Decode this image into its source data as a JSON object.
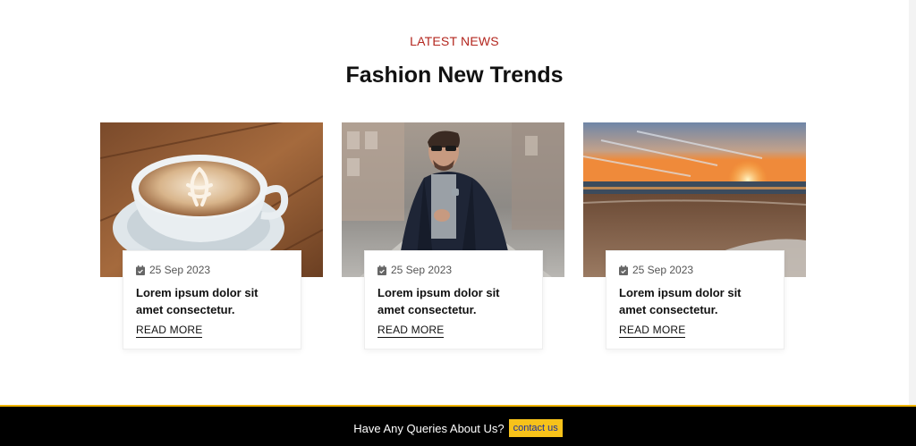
{
  "section": {
    "eyebrow": "LATEST NEWS",
    "title": "Fashion New Trends"
  },
  "cards": [
    {
      "image": "coffee-latte-art-photo",
      "date": "25 Sep 2023",
      "headline": "Lorem ipsum dolor sit amet consectetur.",
      "cta": "READ MORE"
    },
    {
      "image": "man-in-jacket-photo",
      "date": "25 Sep 2023",
      "headline": "Lorem ipsum dolor sit amet consectetur.",
      "cta": "READ MORE"
    },
    {
      "image": "beach-sunset-photo",
      "date": "25 Sep 2023",
      "headline": "Lorem ipsum dolor sit amet consectetur.",
      "cta": "READ MORE"
    }
  ],
  "footer": {
    "question": "Have Any Queries About Us?",
    "button": "contact us"
  },
  "colors": {
    "eyebrow": "#b3261e",
    "footer_bg": "#000000",
    "footer_border": "#f0b400",
    "button_bg": "#f7c21a",
    "button_text": "#1a2f9e"
  }
}
